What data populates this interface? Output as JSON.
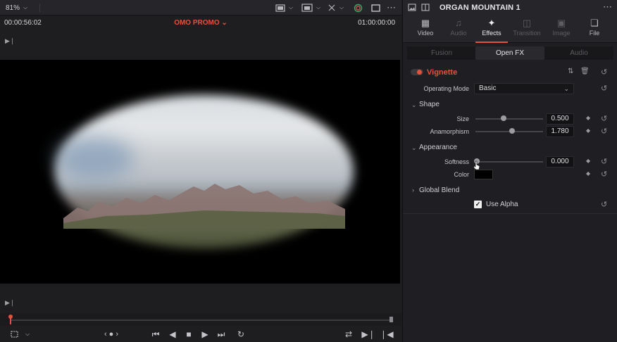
{
  "viewer": {
    "zoom": "81%",
    "timecode_left": "00:00:56:02",
    "timeline_name": "OMO PROMO",
    "timecode_right": "01:00:00:00"
  },
  "inspector": {
    "clip_title": "ORGAN MOUNTAIN 1",
    "tabs": [
      {
        "label": "Video",
        "icon": "film-icon"
      },
      {
        "label": "Audio",
        "icon": "music-note-icon"
      },
      {
        "label": "Effects",
        "icon": "magic-wand-icon"
      },
      {
        "label": "Transition",
        "icon": "transition-icon"
      },
      {
        "label": "Image",
        "icon": "image-icon"
      },
      {
        "label": "File",
        "icon": "file-icon"
      }
    ],
    "active_tab": "Effects",
    "sub_tabs": [
      "Fusion",
      "Open FX",
      "Audio"
    ],
    "active_sub_tab": "Open FX",
    "effect": {
      "name": "Vignette",
      "operating_mode_label": "Operating Mode",
      "operating_mode_value": "Basic",
      "shape_section": "Shape",
      "size_label": "Size",
      "size_value": "0.500",
      "anamorphism_label": "Anamorphism",
      "anamorphism_value": "1.780",
      "appearance_section": "Appearance",
      "softness_label": "Softness",
      "softness_value": "0.000",
      "color_label": "Color",
      "global_blend_section": "Global Blend",
      "use_alpha_label": "Use Alpha",
      "use_alpha_checked": true
    },
    "accent_color": "#e0533c"
  }
}
